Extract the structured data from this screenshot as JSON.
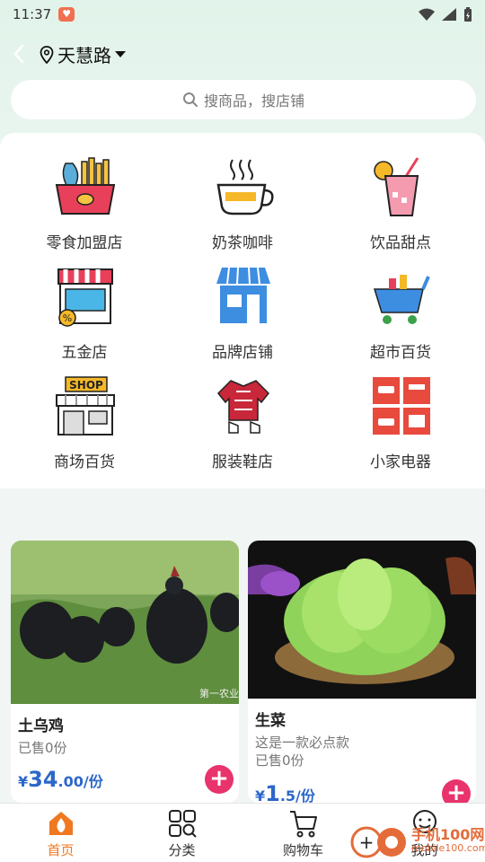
{
  "status": {
    "time": "11:37"
  },
  "header": {
    "location": "天慧路"
  },
  "search": {
    "placeholder": "搜商品，搜店铺"
  },
  "categories": [
    {
      "label": "零食加盟店",
      "icon": "snack-basket-icon"
    },
    {
      "label": "奶茶咖啡",
      "icon": "coffee-cup-icon"
    },
    {
      "label": "饮品甜点",
      "icon": "drink-glass-icon"
    },
    {
      "label": "五金店",
      "icon": "hardware-store-icon"
    },
    {
      "label": "品牌店铺",
      "icon": "brand-shop-icon"
    },
    {
      "label": "超市百货",
      "icon": "shopping-cart-icon"
    },
    {
      "label": "商场百货",
      "icon": "mall-shop-icon"
    },
    {
      "label": "服装鞋店",
      "icon": "clothing-icon"
    },
    {
      "label": "小家电器",
      "icon": "appliances-icon"
    }
  ],
  "shop_sign": "SHOP",
  "products": [
    {
      "name": "土乌鸡",
      "desc": "",
      "sold": "已售0份",
      "price_symbol": "¥",
      "price_int": "34",
      "price_dec": ".00/份",
      "photo_caption": "第一农业"
    },
    {
      "name": "生菜",
      "desc": "这是一款必点款",
      "sold": "已售0份",
      "price_symbol": "¥",
      "price_int": "1",
      "price_dec": ".5/份"
    }
  ],
  "tabs": [
    {
      "label": "首页",
      "icon": "home-icon",
      "active": true
    },
    {
      "label": "分类",
      "icon": "category-grid-icon",
      "active": false
    },
    {
      "label": "购物车",
      "icon": "cart-icon",
      "active": false
    },
    {
      "label": "我的",
      "icon": "profile-icon",
      "active": false
    }
  ],
  "watermark": {
    "text": "手机100网",
    "url": "mobile100.com"
  },
  "colors": {
    "accent": "#f07820",
    "price": "#2c67c9",
    "add": "#e8336d"
  }
}
